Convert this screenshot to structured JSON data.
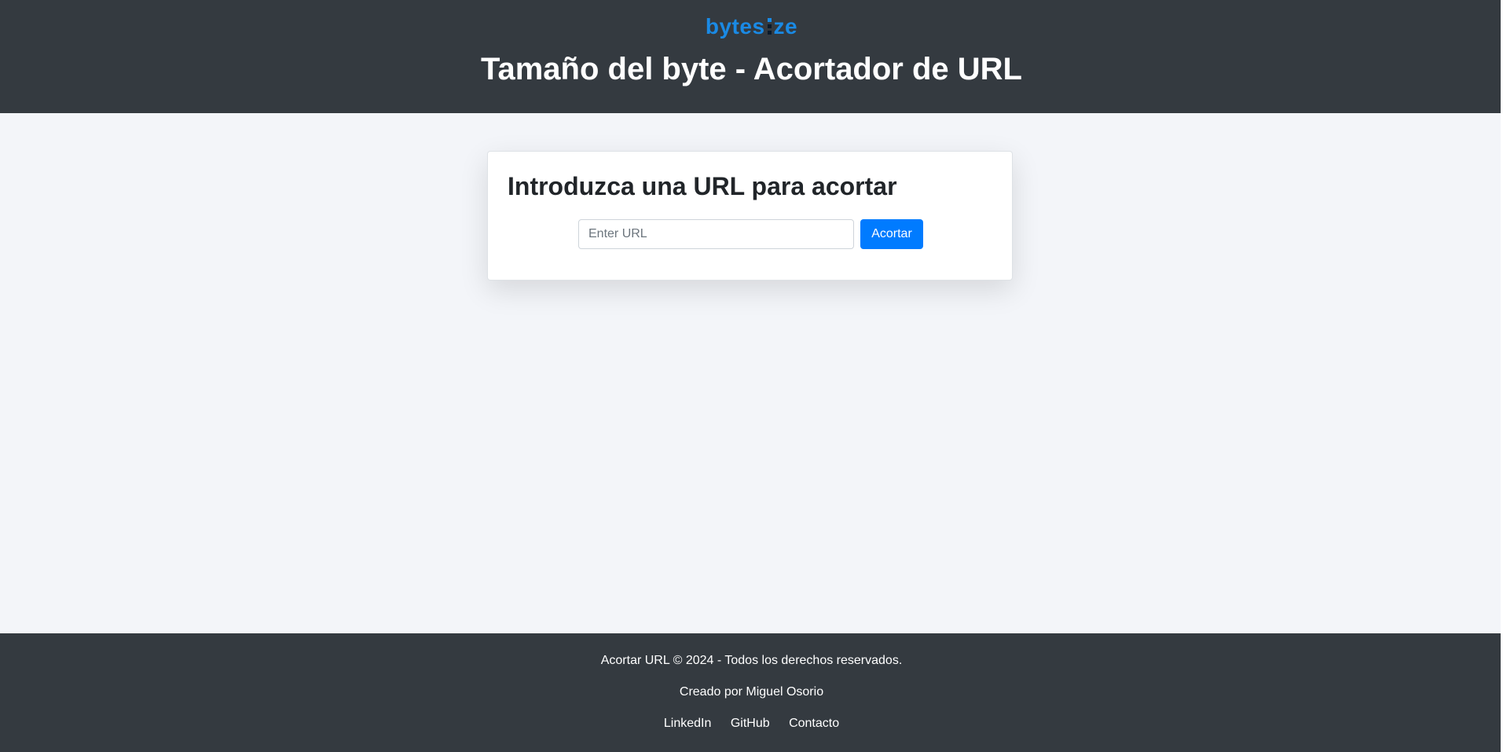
{
  "header": {
    "logo": {
      "text_before": "bytes",
      "text_after": "ze",
      "color": "#1a8ae5"
    },
    "title": "Tamaño del byte - Acortador de URL",
    "background": "#343a40"
  },
  "main": {
    "background": "#f3f5f9",
    "card": {
      "heading": "Introduzca una URL para acortar",
      "input": {
        "value": "",
        "placeholder": "Enter URL"
      },
      "button_label": "Acortar",
      "button_color": "#007bff"
    }
  },
  "footer": {
    "copyright": "Acortar URL © 2024 - Todos los derechos reservados.",
    "credit": "Creado por Miguel Osorio",
    "links": [
      {
        "label": "LinkedIn"
      },
      {
        "label": "GitHub"
      },
      {
        "label": "Contacto"
      }
    ]
  }
}
